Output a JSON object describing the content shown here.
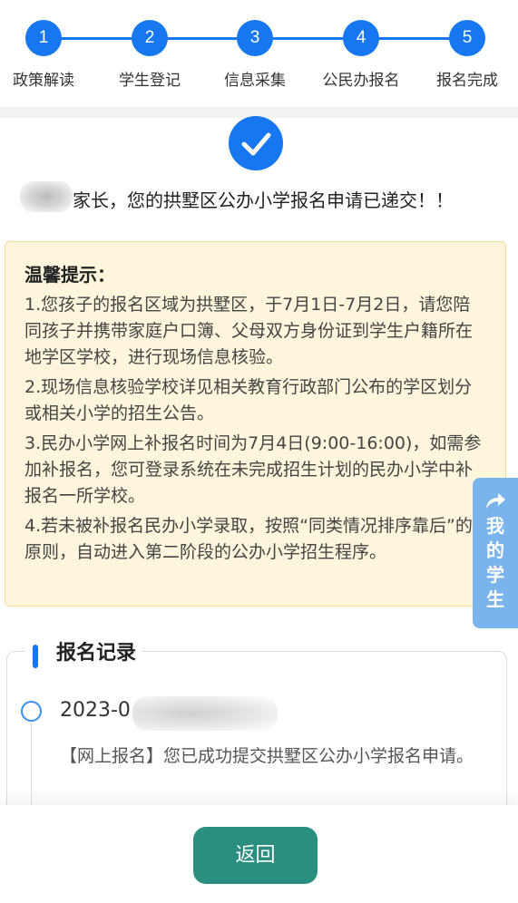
{
  "steps": [
    {
      "num": "1",
      "label": "政策解读"
    },
    {
      "num": "2",
      "label": "学生登记"
    },
    {
      "num": "3",
      "label": "信息采集"
    },
    {
      "num": "4",
      "label": "公民办报名"
    },
    {
      "num": "5",
      "label": "报名完成"
    }
  ],
  "success": {
    "message": "家长，您的拱墅区公办小学报名申请已递交！！"
  },
  "tips": {
    "title": "温馨提示：",
    "items": [
      "1.您孩子的报名区域为拱墅区，于7月1日-7月2日，请您陪同孩子并携带家庭户口簿、父母双方身份证到学生户籍所在地学区学校，进行现场信息核验。",
      "2.现场信息核验学校详见相关教育行政部门公布的学区划分或相关小学的招生公告。",
      "3.民办小学网上补报名时间为7月4日(9:00-16:00)，如需参加补报名，您可登录系统在未完成招生计划的民办小学中补报名一所学校。",
      "4.若未被补报名民办小学录取，按照“同类情况排序靠后”的原则，自动进入第二阶段的公办小学招生程序。"
    ]
  },
  "side_button": {
    "chars": [
      "我",
      "的",
      "学",
      "生"
    ],
    "icon": "share-arrow-icon"
  },
  "record": {
    "title": "报名记录",
    "entries": [
      {
        "date": "2023-0",
        "desc": "【网上报名】您已成功提交拱墅区公办小学报名申请。"
      }
    ]
  },
  "back_button": {
    "label": "返回"
  },
  "colors": {
    "primary": "#1677f0",
    "tip_bg": "#fdf6dc",
    "back_button": "#2a8f7e",
    "side_button": "#7ab4ec"
  }
}
